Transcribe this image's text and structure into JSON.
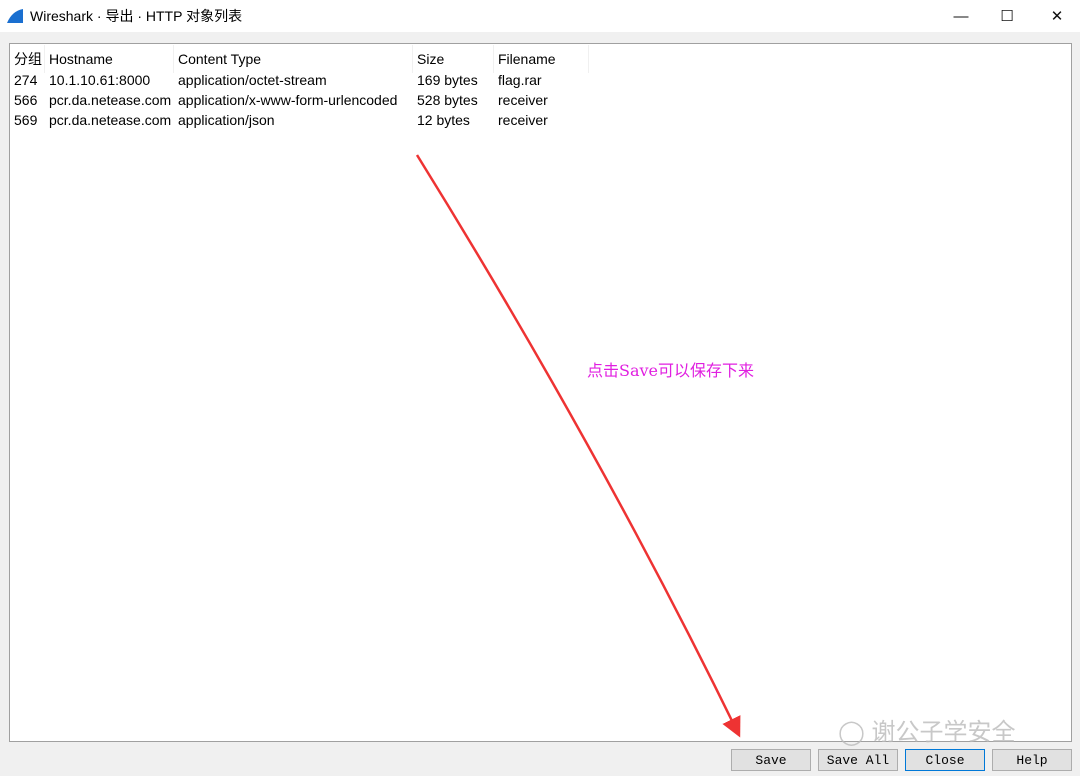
{
  "window": {
    "title": "Wireshark · 导出 · HTTP 对象列表"
  },
  "columns": [
    "分组",
    "Hostname",
    "Content Type",
    "Size",
    "Filename"
  ],
  "rows": [
    [
      "274",
      "10.1.10.61:8000",
      "application/octet-stream",
      "169 bytes",
      "flag.rar"
    ],
    [
      "566",
      "pcr.da.netease.com",
      "application/x-www-form-urlencoded",
      "528 bytes",
      "receiver"
    ],
    [
      "569",
      "pcr.da.netease.com",
      "application/json",
      "12 bytes",
      "receiver"
    ]
  ],
  "buttons": {
    "save": "Save",
    "save_all": "Save All",
    "close": "Close",
    "help": "Help"
  },
  "annotation": {
    "text": "点击Save可以保存下来",
    "color": "#e020e0",
    "arrow_color": "#ee3333"
  },
  "watermark": "谢公子学安全"
}
